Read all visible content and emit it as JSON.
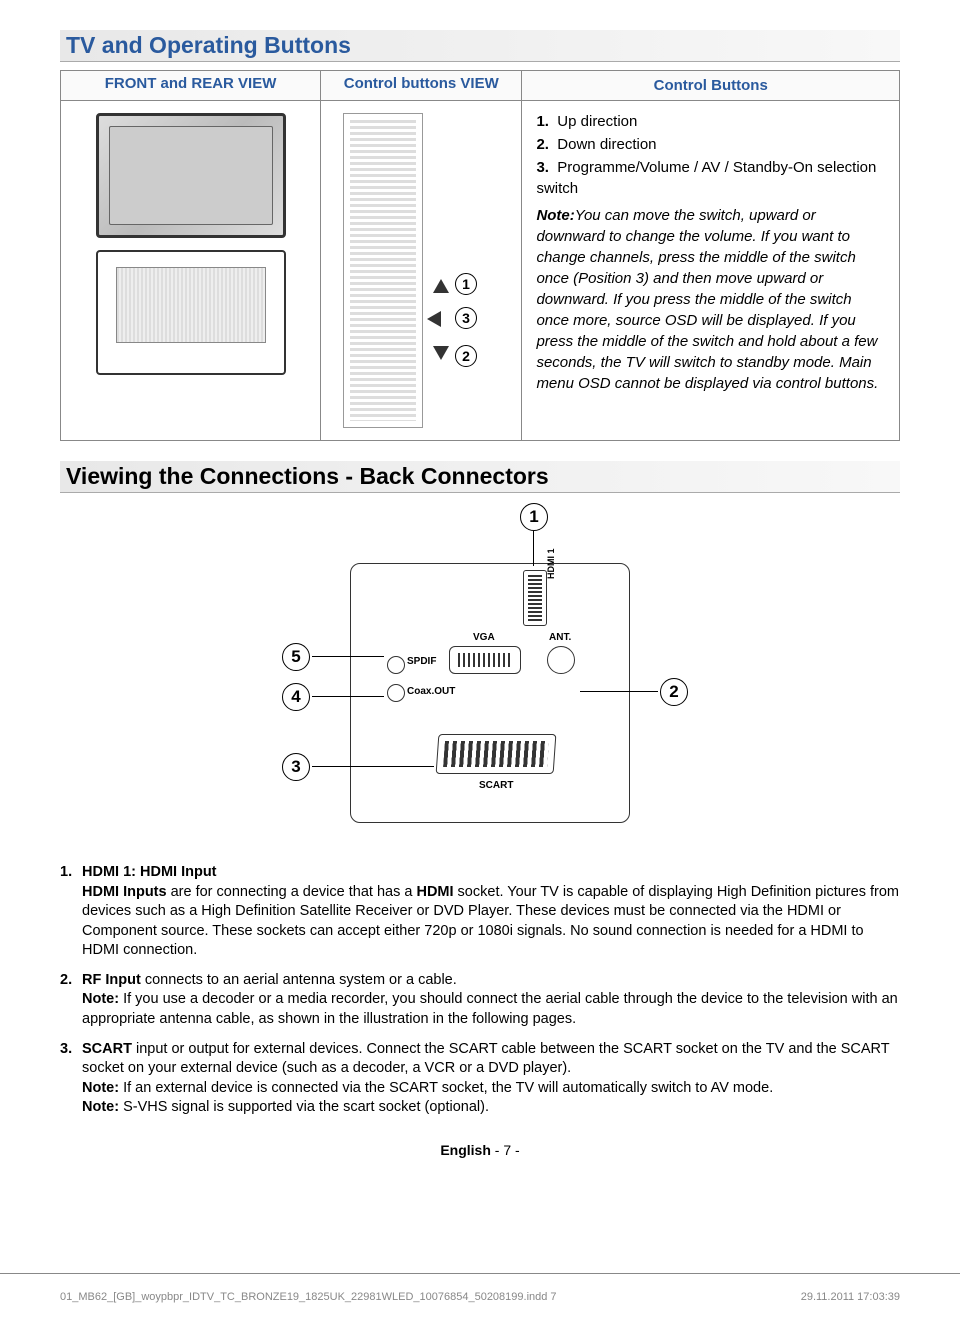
{
  "section1": {
    "title": "TV and Operating Buttons",
    "col_headers": [
      "FRONT and REAR VIEW",
      "Control buttons VIEW",
      "Control Buttons"
    ],
    "button_nums": [
      "1",
      "2",
      "3"
    ],
    "list": [
      {
        "n": "1.",
        "t": "Up direction"
      },
      {
        "n": "2.",
        "t": "Down direction"
      },
      {
        "n": "3.",
        "t": "Programme/Volume / AV / Standby-On selection switch"
      }
    ],
    "note_label": "Note:",
    "note_body": "You can move the switch, upward or downward to change the volume. If you want to change channels, press the middle of the switch once (Position 3) and then move upward or downward. If you press the middle of the switch once more, source OSD will be displayed. If you press the middle of the switch and hold about a few seconds, the TV will switch to standby mode. Main menu OSD cannot be displayed via control buttons."
  },
  "section2": {
    "title": "Viewing the Connections - Back Connectors",
    "ports": {
      "hdmi": "HDMI 1",
      "vga": "VGA",
      "ant": "ANT.",
      "spdif": "SPDIF",
      "coax": "Coax.OUT",
      "scart": "SCART"
    },
    "callouts": [
      "1",
      "2",
      "3",
      "4",
      "5"
    ],
    "items": [
      {
        "n": "1.",
        "lead_bold": "HDMI 1: HDMI Input",
        "body": "HDMI Inputs are for connecting a device that has a HDMI socket. Your TV is capable of displaying High Definition pictures from devices such as a High Definition Satellite Receiver or DVD Player. These devices must be connected via the HDMI or Component source. These sockets can accept either 720p or 1080i signals. No sound connection is needed for a HDMI to HDMI connection.",
        "body_bold_frag": "HDMI Inputs"
      },
      {
        "n": "2.",
        "lead_bold": "RF Input",
        "lead_tail": " connects to an aerial antenna system or a cable.",
        "note_bold": "Note:",
        "note_body": " If you use a decoder or a media recorder, you should connect the aerial cable through the device to the television with an appropriate antenna cable, as shown in the illustration in the following pages."
      },
      {
        "n": "3.",
        "lead_bold": "SCART",
        "lead_tail": "  input or output for external devices. Connect the SCART cable between the SCART socket on the TV and the SCART socket on your external device (such as a decoder, a VCR or a DVD player).",
        "note1_bold": "Note:",
        "note1_body": " If an external device is connected via the SCART socket, the TV will automatically switch to AV mode.",
        "note2_bold": "Note:",
        "note2_body": " S-VHS signal is supported via the scart socket (optional)."
      }
    ]
  },
  "footer": {
    "center_lang": "English",
    "center_page": "  - 7 -",
    "bl": "01_MB62_[GB]_woypbpr_IDTV_TC_BRONZE19_1825UK_22981WLED_10076854_50208199.indd   7",
    "br": "29.11.2011   17:03:39"
  }
}
